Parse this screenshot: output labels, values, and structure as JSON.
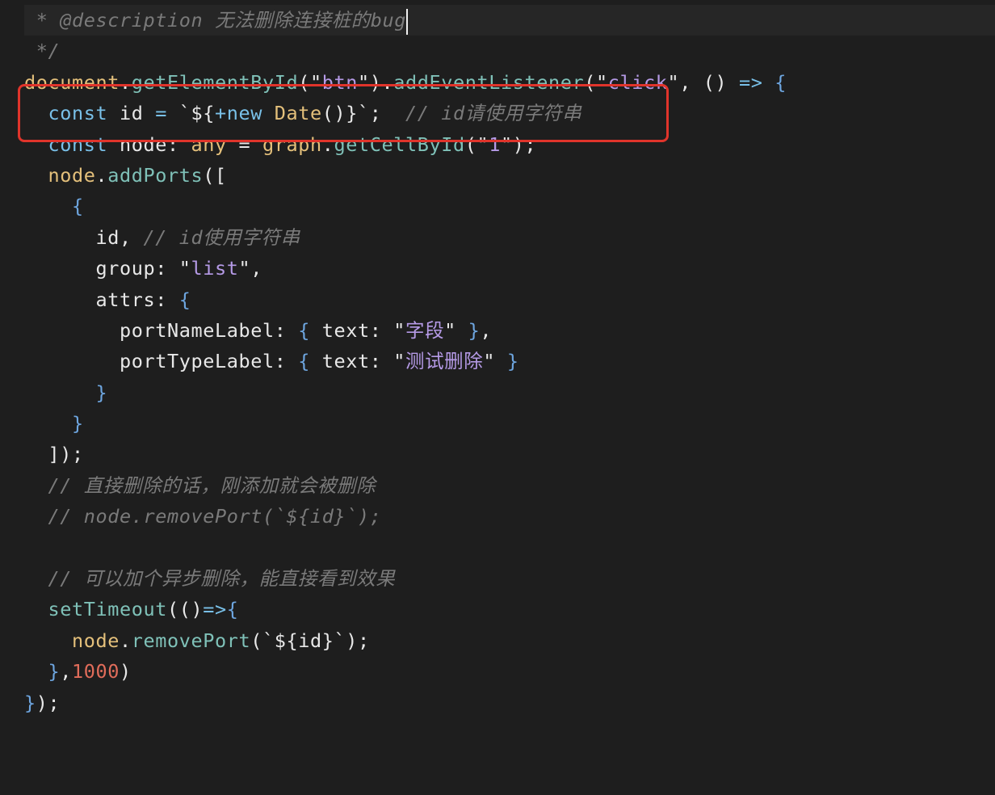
{
  "editor": {
    "lines": [
      [
        {
          "t": " * ",
          "c": "comment"
        },
        {
          "t": "@description",
          "c": "comment"
        },
        {
          "t": " 无法删除连接桩的bug",
          "c": "comment"
        }
      ],
      [
        {
          "t": " */",
          "c": "comment"
        }
      ],
      [
        {
          "t": "document",
          "c": "var"
        },
        {
          "t": ".",
          "c": "plain"
        },
        {
          "t": "getElementById",
          "c": "fn"
        },
        {
          "t": "(\"",
          "c": "plain"
        },
        {
          "t": "btn",
          "c": "str"
        },
        {
          "t": "\").",
          "c": "plain"
        },
        {
          "t": "addEventListener",
          "c": "fn"
        },
        {
          "t": "(\"",
          "c": "plain"
        },
        {
          "t": "click",
          "c": "str"
        },
        {
          "t": "\", () ",
          "c": "plain"
        },
        {
          "t": "=>",
          "c": "kw"
        },
        {
          "t": " ",
          "c": "plain"
        },
        {
          "t": "{",
          "c": "brace"
        }
      ],
      [
        {
          "t": "  ",
          "c": "plain"
        },
        {
          "t": "const",
          "c": "kw"
        },
        {
          "t": " id ",
          "c": "plain"
        },
        {
          "t": "=",
          "c": "kw"
        },
        {
          "t": " `${",
          "c": "plain"
        },
        {
          "t": "+new",
          "c": "kw"
        },
        {
          "t": " ",
          "c": "plain"
        },
        {
          "t": "Date",
          "c": "var"
        },
        {
          "t": "()}`",
          "c": "plain"
        },
        {
          "t": ";  ",
          "c": "plain"
        },
        {
          "t": "// id请使用字符串",
          "c": "comment"
        }
      ],
      [
        {
          "t": "  ",
          "c": "plain"
        },
        {
          "t": "const",
          "c": "kw"
        },
        {
          "t": " node",
          "c": "plain"
        },
        {
          "t": ": ",
          "c": "plain"
        },
        {
          "t": "any",
          "c": "var"
        },
        {
          "t": " = ",
          "c": "plain"
        },
        {
          "t": "graph",
          "c": "var"
        },
        {
          "t": ".",
          "c": "plain"
        },
        {
          "t": "getCellById",
          "c": "fn"
        },
        {
          "t": "(\"",
          "c": "plain"
        },
        {
          "t": "1",
          "c": "str"
        },
        {
          "t": "\");",
          "c": "plain"
        }
      ],
      [
        {
          "t": "  ",
          "c": "plain"
        },
        {
          "t": "node",
          "c": "var"
        },
        {
          "t": ".",
          "c": "plain"
        },
        {
          "t": "addPorts",
          "c": "fn"
        },
        {
          "t": "([",
          "c": "plain"
        }
      ],
      [
        {
          "t": "    ",
          "c": "plain"
        },
        {
          "t": "{",
          "c": "brace"
        }
      ],
      [
        {
          "t": "      id, ",
          "c": "plain"
        },
        {
          "t": "// id使用字符串",
          "c": "comment"
        }
      ],
      [
        {
          "t": "      group: \"",
          "c": "plain"
        },
        {
          "t": "list",
          "c": "str"
        },
        {
          "t": "\",",
          "c": "plain"
        }
      ],
      [
        {
          "t": "      attrs: ",
          "c": "plain"
        },
        {
          "t": "{",
          "c": "brace"
        }
      ],
      [
        {
          "t": "        portNameLabel: ",
          "c": "plain"
        },
        {
          "t": "{",
          "c": "brace"
        },
        {
          "t": " text: \"",
          "c": "plain"
        },
        {
          "t": "字段",
          "c": "str"
        },
        {
          "t": "\" ",
          "c": "plain"
        },
        {
          "t": "}",
          "c": "brace"
        },
        {
          "t": ",",
          "c": "plain"
        }
      ],
      [
        {
          "t": "        portTypeLabel: ",
          "c": "plain"
        },
        {
          "t": "{",
          "c": "brace"
        },
        {
          "t": " text: \"",
          "c": "plain"
        },
        {
          "t": "测试删除",
          "c": "str"
        },
        {
          "t": "\" ",
          "c": "plain"
        },
        {
          "t": "}",
          "c": "brace"
        }
      ],
      [
        {
          "t": "      ",
          "c": "plain"
        },
        {
          "t": "}",
          "c": "brace"
        }
      ],
      [
        {
          "t": "    ",
          "c": "plain"
        },
        {
          "t": "}",
          "c": "brace"
        }
      ],
      [
        {
          "t": "  ]);",
          "c": "plain"
        }
      ],
      [
        {
          "t": "  ",
          "c": "plain"
        },
        {
          "t": "// 直接删除的话，刚添加就会被删除",
          "c": "comment"
        }
      ],
      [
        {
          "t": "  ",
          "c": "plain"
        },
        {
          "t": "// node.removePort(`${id}`);",
          "c": "comment"
        }
      ],
      [
        {
          "t": "",
          "c": "plain"
        }
      ],
      [
        {
          "t": "  ",
          "c": "plain"
        },
        {
          "t": "// 可以加个异步删除，能直接看到效果",
          "c": "comment"
        }
      ],
      [
        {
          "t": "  ",
          "c": "plain"
        },
        {
          "t": "setTimeout",
          "c": "fn"
        },
        {
          "t": "(()",
          "c": "plain"
        },
        {
          "t": "=>",
          "c": "kw"
        },
        {
          "t": "{",
          "c": "brace"
        }
      ],
      [
        {
          "t": "    ",
          "c": "plain"
        },
        {
          "t": "node",
          "c": "var"
        },
        {
          "t": ".",
          "c": "plain"
        },
        {
          "t": "removePort",
          "c": "fn"
        },
        {
          "t": "(`${id}`);",
          "c": "plain"
        }
      ],
      [
        {
          "t": "  ",
          "c": "plain"
        },
        {
          "t": "}",
          "c": "brace"
        },
        {
          "t": ",",
          "c": "plain"
        },
        {
          "t": "1000",
          "c": "num"
        },
        {
          "t": ")",
          "c": "plain"
        }
      ],
      [
        {
          "t": "}",
          "c": "brace"
        },
        {
          "t": ");",
          "c": "plain"
        }
      ]
    ],
    "highlight_color": "#e0342b",
    "background": "#1e1e1e"
  }
}
